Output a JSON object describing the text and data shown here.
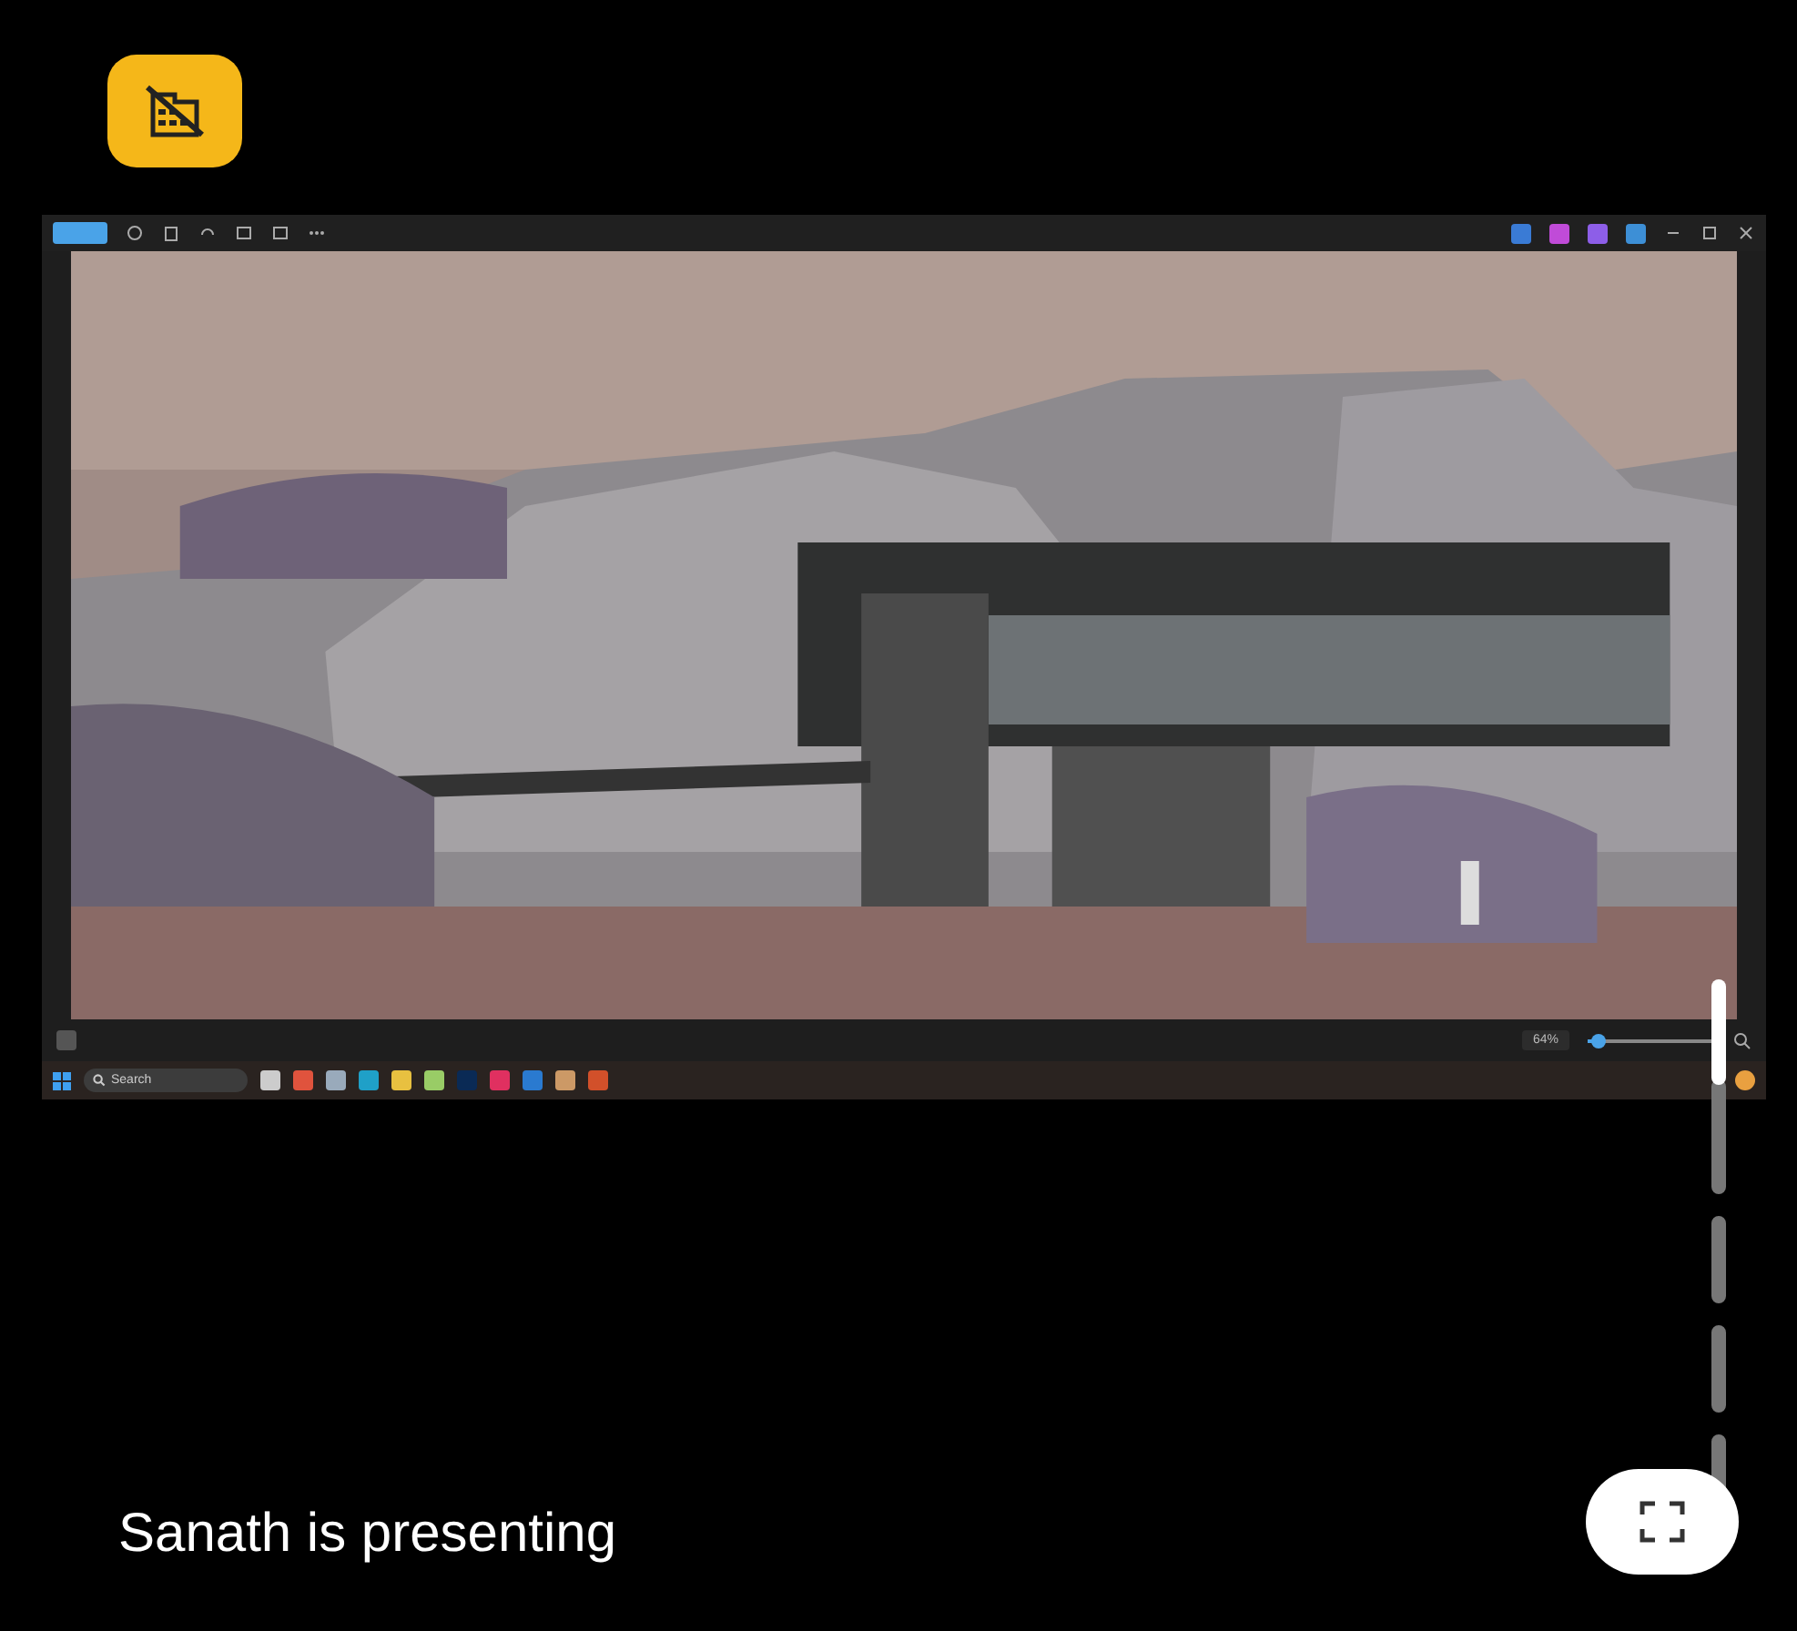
{
  "shared_screen": {
    "search_placeholder": "Search",
    "zoom": {
      "reading": "64%",
      "level": 0.08
    }
  },
  "caption": "Sanath is presenting"
}
